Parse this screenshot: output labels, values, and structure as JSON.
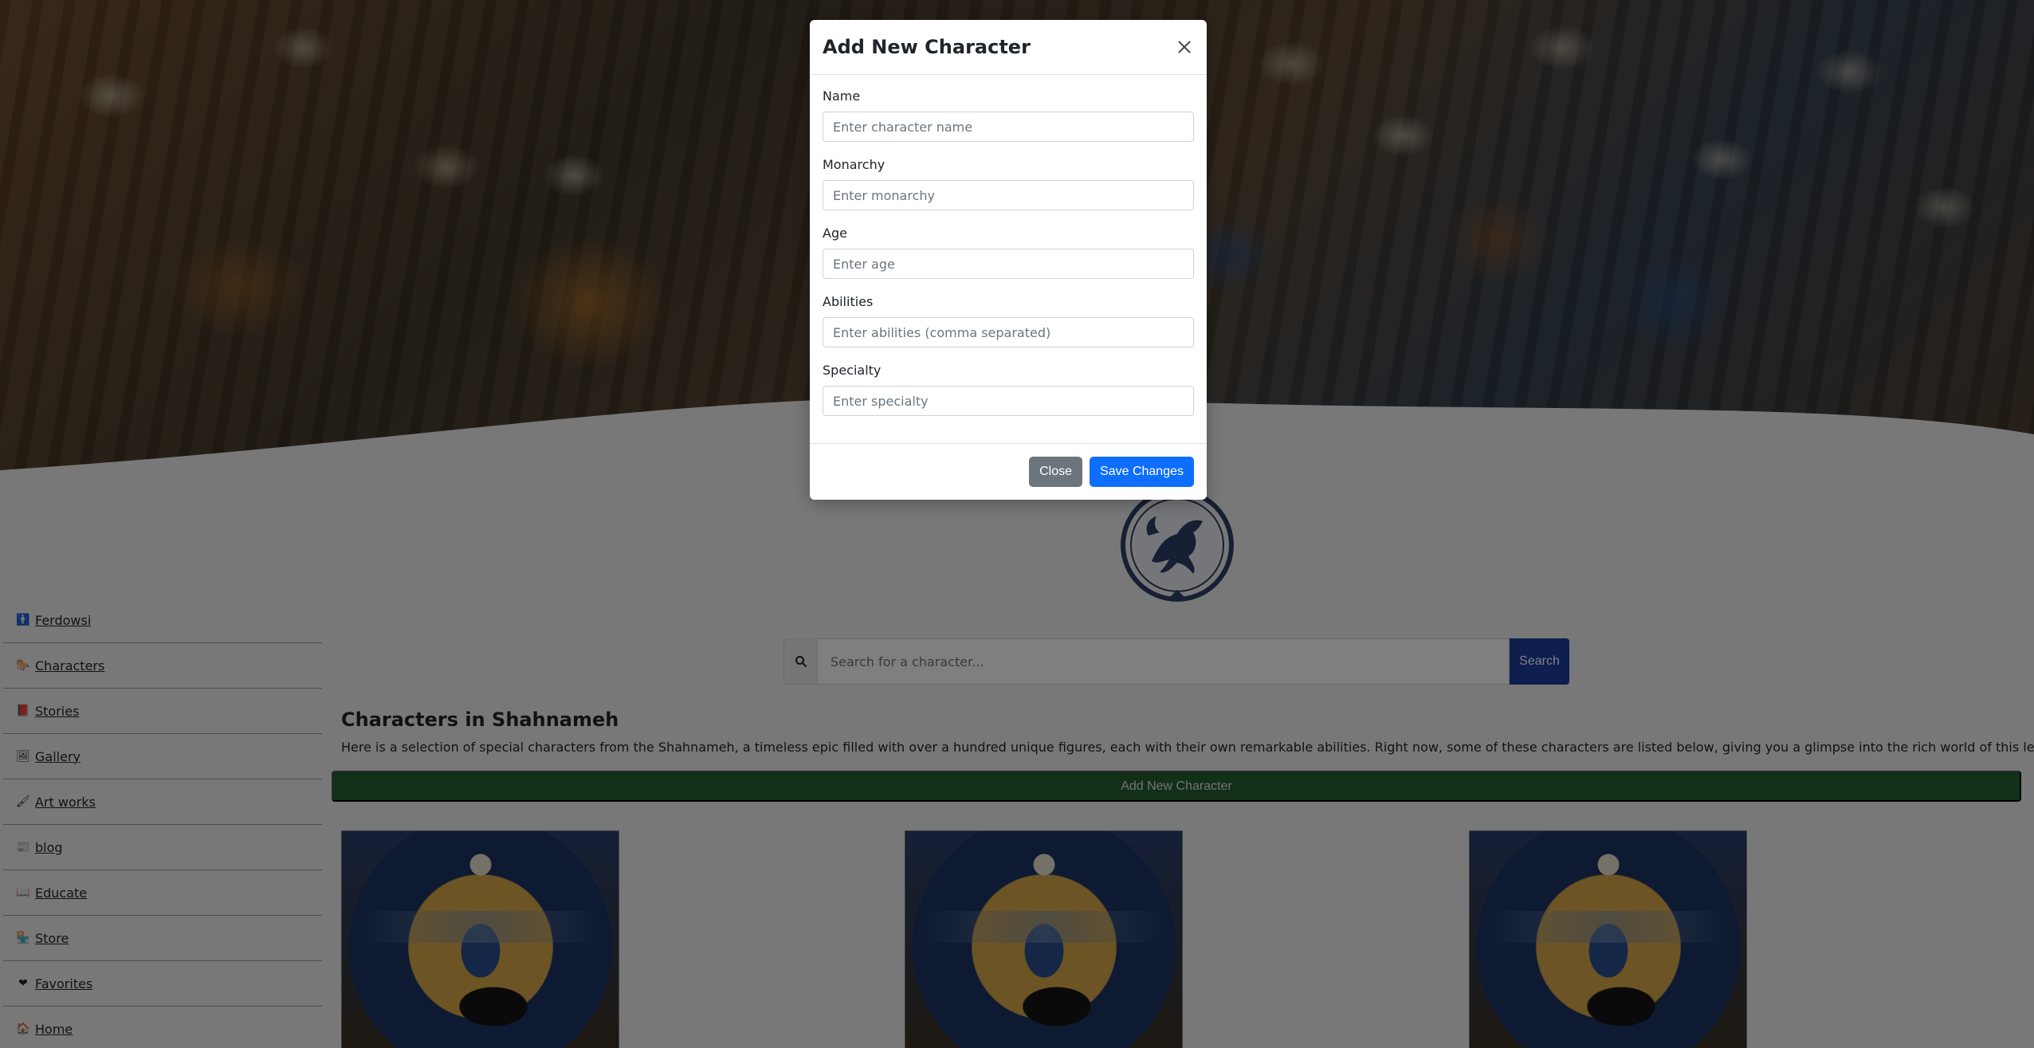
{
  "sidebar": {
    "items": [
      {
        "icon": "person-icon",
        "glyph": "🚹",
        "label": "Ferdowsi"
      },
      {
        "icon": "horse-icon",
        "glyph": "🐎",
        "label": "Characters"
      },
      {
        "icon": "book-icon",
        "glyph": "📕",
        "label": "Stories"
      },
      {
        "icon": "image-icon",
        "glyph": "🖼",
        "label": "Gallery"
      },
      {
        "icon": "paint-brush-icon",
        "glyph": "🖌",
        "label": "Art works"
      },
      {
        "icon": "blog-icon",
        "glyph": "📰",
        "label": "blog"
      },
      {
        "icon": "open-book-icon",
        "glyph": "📖",
        "label": "Educate"
      },
      {
        "icon": "store-icon",
        "glyph": "🏪",
        "label": "Store"
      },
      {
        "icon": "heart-icon",
        "glyph": "❤",
        "label": "Favorites"
      },
      {
        "icon": "home-icon",
        "glyph": "🏠",
        "label": "Home"
      }
    ]
  },
  "search": {
    "placeholder": "Search for a character...",
    "button_label": "Search"
  },
  "main": {
    "title": "Characters in Shahnameh",
    "description": "Here is a selection of special characters from the Shahnameh, a timeless epic filled with over a hundred unique figures, each with their own remarkable abilities. Right now, some of these characters are listed below, giving you a glimpse into the rich world of this legendary story.",
    "add_button_label": "Add New Character"
  },
  "modal": {
    "title": "Add New Character",
    "fields": [
      {
        "label": "Name",
        "placeholder": "Enter character name"
      },
      {
        "label": "Monarchy",
        "placeholder": "Enter monarchy"
      },
      {
        "label": "Age",
        "placeholder": "Enter age"
      },
      {
        "label": "Abilities",
        "placeholder": "Enter abilities (comma separated)"
      },
      {
        "label": "Specialty",
        "placeholder": "Enter specialty"
      }
    ],
    "close_label": "Close",
    "save_label": "Save Changes"
  },
  "colors": {
    "primary": "#0d6efd",
    "secondary": "#6c757d",
    "search_button": "#1d3d9e",
    "add_bar": "#245f30"
  }
}
